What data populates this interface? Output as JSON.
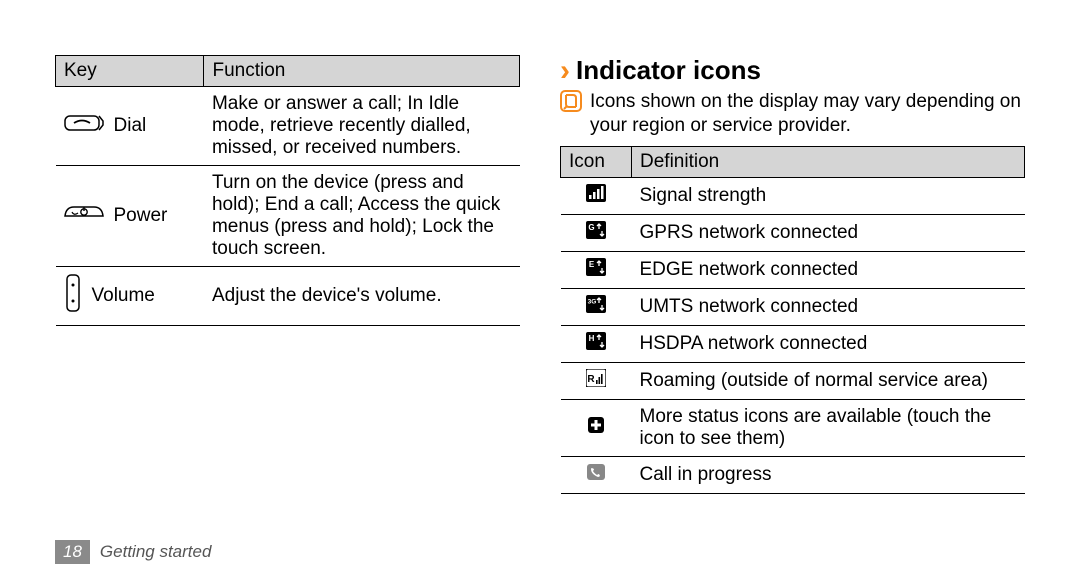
{
  "key_table": {
    "headers": [
      "Key",
      "Function"
    ],
    "rows": [
      {
        "icon": "dial-key-icon",
        "key": "Dial",
        "func": "Make or answer a call; In Idle mode, retrieve recently dialled, missed, or received numbers."
      },
      {
        "icon": "power-key-icon",
        "key": "Power",
        "func": "Turn on the device (press and hold); End a call; Access the quick menus (press and hold); Lock the touch screen."
      },
      {
        "icon": "volume-key-icon",
        "key": "Volume",
        "func": "Adjust the device's volume."
      }
    ]
  },
  "heading": {
    "caret": "›",
    "title": "Indicator icons"
  },
  "note": "Icons shown on the display may vary depending on your region or service provider.",
  "icon_table": {
    "headers": [
      "Icon",
      "Definition"
    ],
    "rows": [
      {
        "icon": "signal-icon",
        "def": "Signal strength"
      },
      {
        "icon": "gprs-icon",
        "def": "GPRS network connected"
      },
      {
        "icon": "edge-icon",
        "def": "EDGE network connected"
      },
      {
        "icon": "umts-icon",
        "def": "UMTS network connected"
      },
      {
        "icon": "hsdpa-icon",
        "def": "HSDPA network connected"
      },
      {
        "icon": "roaming-icon",
        "def": "Roaming (outside of normal service area)"
      },
      {
        "icon": "more-status-icon",
        "def": "More status icons are available (touch the icon to see them)"
      },
      {
        "icon": "call-progress-icon",
        "def": "Call in progress"
      }
    ]
  },
  "footer": {
    "page": "18",
    "section": "Getting started"
  }
}
